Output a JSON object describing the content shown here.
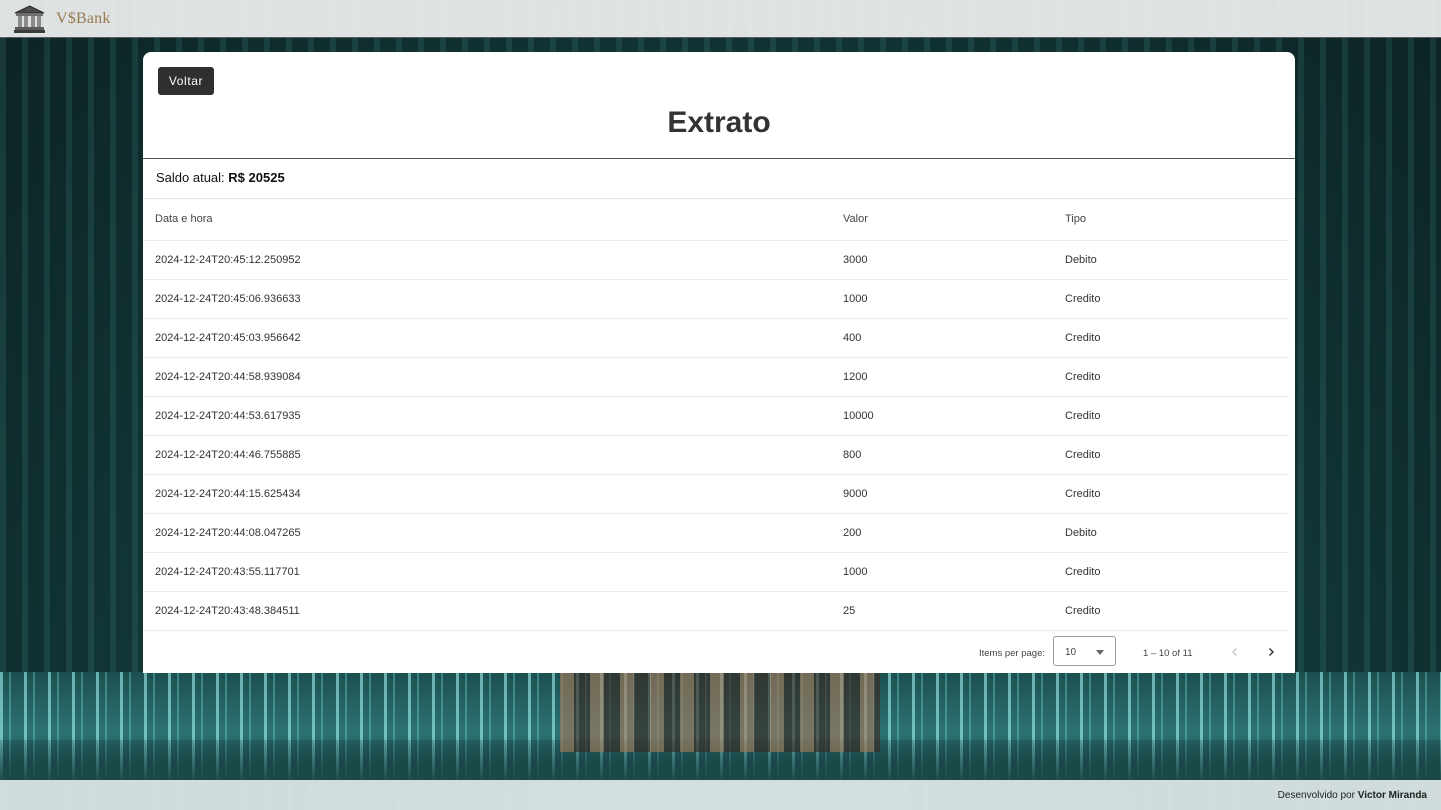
{
  "app": {
    "brand": "V$Bank"
  },
  "card": {
    "back_label": "Voltar",
    "title": "Extrato",
    "saldo_label": "Saldo atual:",
    "saldo_value": "R$ 20525"
  },
  "table": {
    "headers": [
      "Data e hora",
      "Valor",
      "Tipo"
    ],
    "rows": [
      [
        "2024-12-24T20:45:12.250952",
        "3000",
        "Debito"
      ],
      [
        "2024-12-24T20:45:06.936633",
        "1000",
        "Credito"
      ],
      [
        "2024-12-24T20:45:03.956642",
        "400",
        "Credito"
      ],
      [
        "2024-12-24T20:44:58.939084",
        "1200",
        "Credito"
      ],
      [
        "2024-12-24T20:44:53.617935",
        "10000",
        "Credito"
      ],
      [
        "2024-12-24T20:44:46.755885",
        "800",
        "Credito"
      ],
      [
        "2024-12-24T20:44:15.625434",
        "9000",
        "Credito"
      ],
      [
        "2024-12-24T20:44:08.047265",
        "200",
        "Debito"
      ],
      [
        "2024-12-24T20:43:55.117701",
        "1000",
        "Credito"
      ],
      [
        "2024-12-24T20:43:48.384511",
        "25",
        "Credito"
      ]
    ]
  },
  "paginator": {
    "items_label": "Items per page:",
    "page_size": "10",
    "range": "1 – 10 of 11"
  },
  "footer": {
    "prefix": "Desenvolvido por",
    "author": "Victor Miranda"
  }
}
